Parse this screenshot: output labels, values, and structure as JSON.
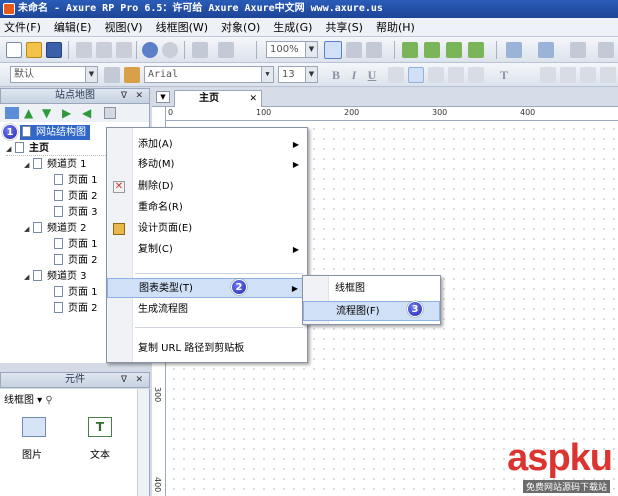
{
  "window": {
    "title": "未命名 - Axure RP Pro 6.5：许可给 Axure Axure中文网 www.axure.us"
  },
  "menubar": [
    "文件(F)",
    "编辑(E)",
    "视图(V)",
    "线框图(W)",
    "对象(O)",
    "生成(G)",
    "共享(S)",
    "帮助(H)"
  ],
  "toolbar": {
    "zoom": "100%",
    "style": "默认",
    "font": "Arial",
    "font_size": "13",
    "bold": "B",
    "italic": "I",
    "underline": "U",
    "text_tool": "T"
  },
  "sitemap": {
    "title": "站点地图",
    "root": "网站结构图",
    "home": "主页",
    "channels": [
      {
        "label": "频道页 1",
        "pages": [
          "页面 1",
          "页面 2",
          "页面 3"
        ]
      },
      {
        "label": "频道页 2",
        "pages": [
          "页面 1",
          "页面 2"
        ]
      },
      {
        "label": "频道页 3",
        "pages": [
          "页面 1",
          "页面 2"
        ]
      }
    ]
  },
  "widgets": {
    "title": "元件",
    "library": "线框图",
    "items": [
      "图片",
      "文本"
    ]
  },
  "canvas": {
    "tab": "主页",
    "ruler_top": [
      "0",
      "100",
      "200",
      "300",
      "400"
    ],
    "ruler_left": [
      "300",
      "400"
    ]
  },
  "context_menu": {
    "items": [
      "添加(A)",
      "移动(M)",
      "删除(D)",
      "重命名(R)",
      "设计页面(E)",
      "复制(C)",
      "图表类型(T)",
      "生成流程图",
      "复制 URL 路径到剪贴板"
    ]
  },
  "submenu": {
    "items": [
      "线框图",
      "流程图(F)"
    ]
  },
  "badges": [
    "1",
    "2",
    "3"
  ],
  "watermark": {
    "main": "aspku",
    "sub": "免费网站源码下载站"
  },
  "colors": {
    "highlight": "#cfe0f7",
    "titlebar": "#1d4597",
    "badge": "#2328b0"
  }
}
